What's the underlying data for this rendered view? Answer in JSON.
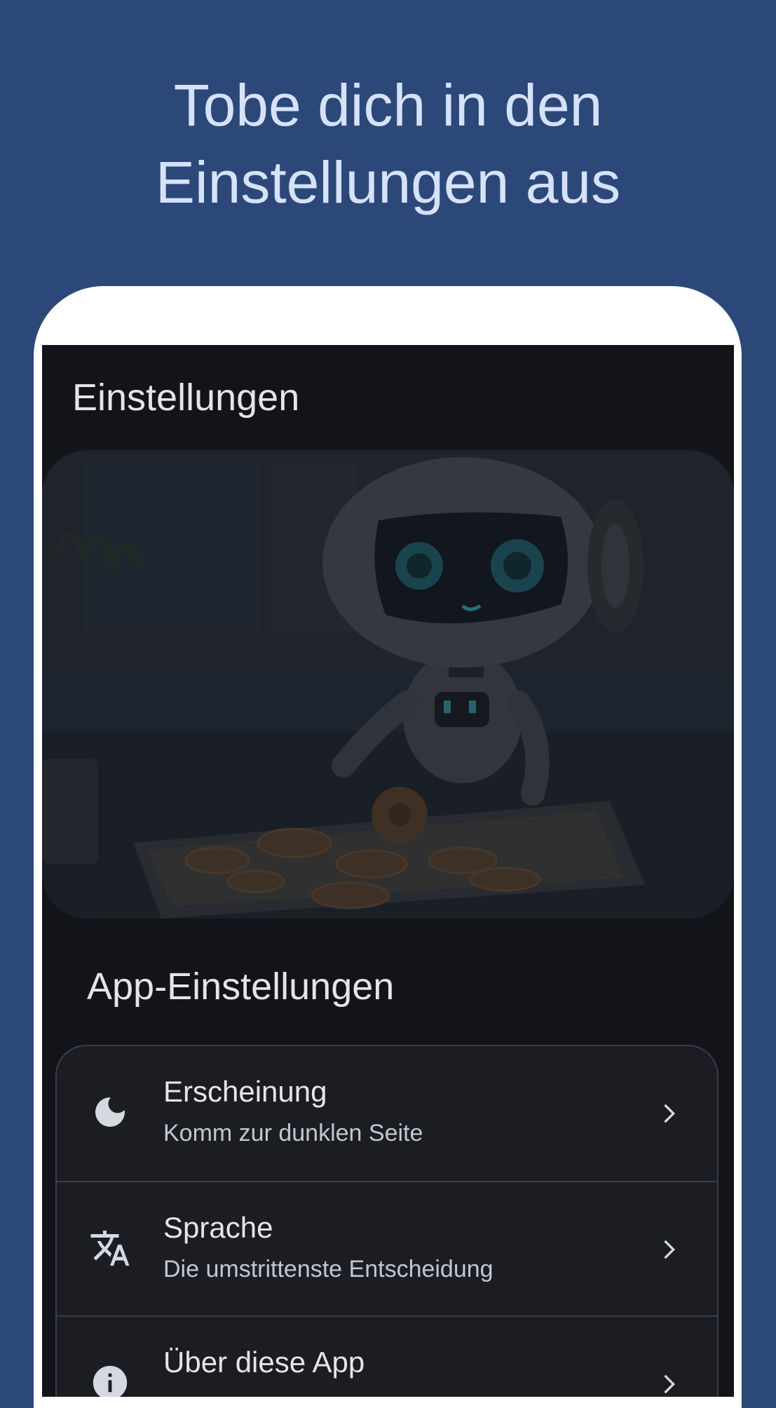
{
  "headline": {
    "line1": "Tobe dich in den",
    "line2": "Einstellungen aus"
  },
  "screen": {
    "title": "Einstellungen",
    "hero_image": "robot-baking-cookies-illustration",
    "section_title": "App-Einstellungen",
    "items": [
      {
        "icon": "moon-icon",
        "label": "Erscheinung",
        "subtitle": "Komm zur dunklen Seite"
      },
      {
        "icon": "translate-icon",
        "label": "Sprache",
        "subtitle": "Die umstrittenste Entscheidung"
      },
      {
        "icon": "info-icon",
        "label": "Über diese App"
      }
    ]
  },
  "colors": {
    "background": "#2b4878",
    "headline": "#d6e2fb",
    "screen_bg": "#121419",
    "card_bg": "#1b1d23",
    "text": "#e4e5ea"
  }
}
